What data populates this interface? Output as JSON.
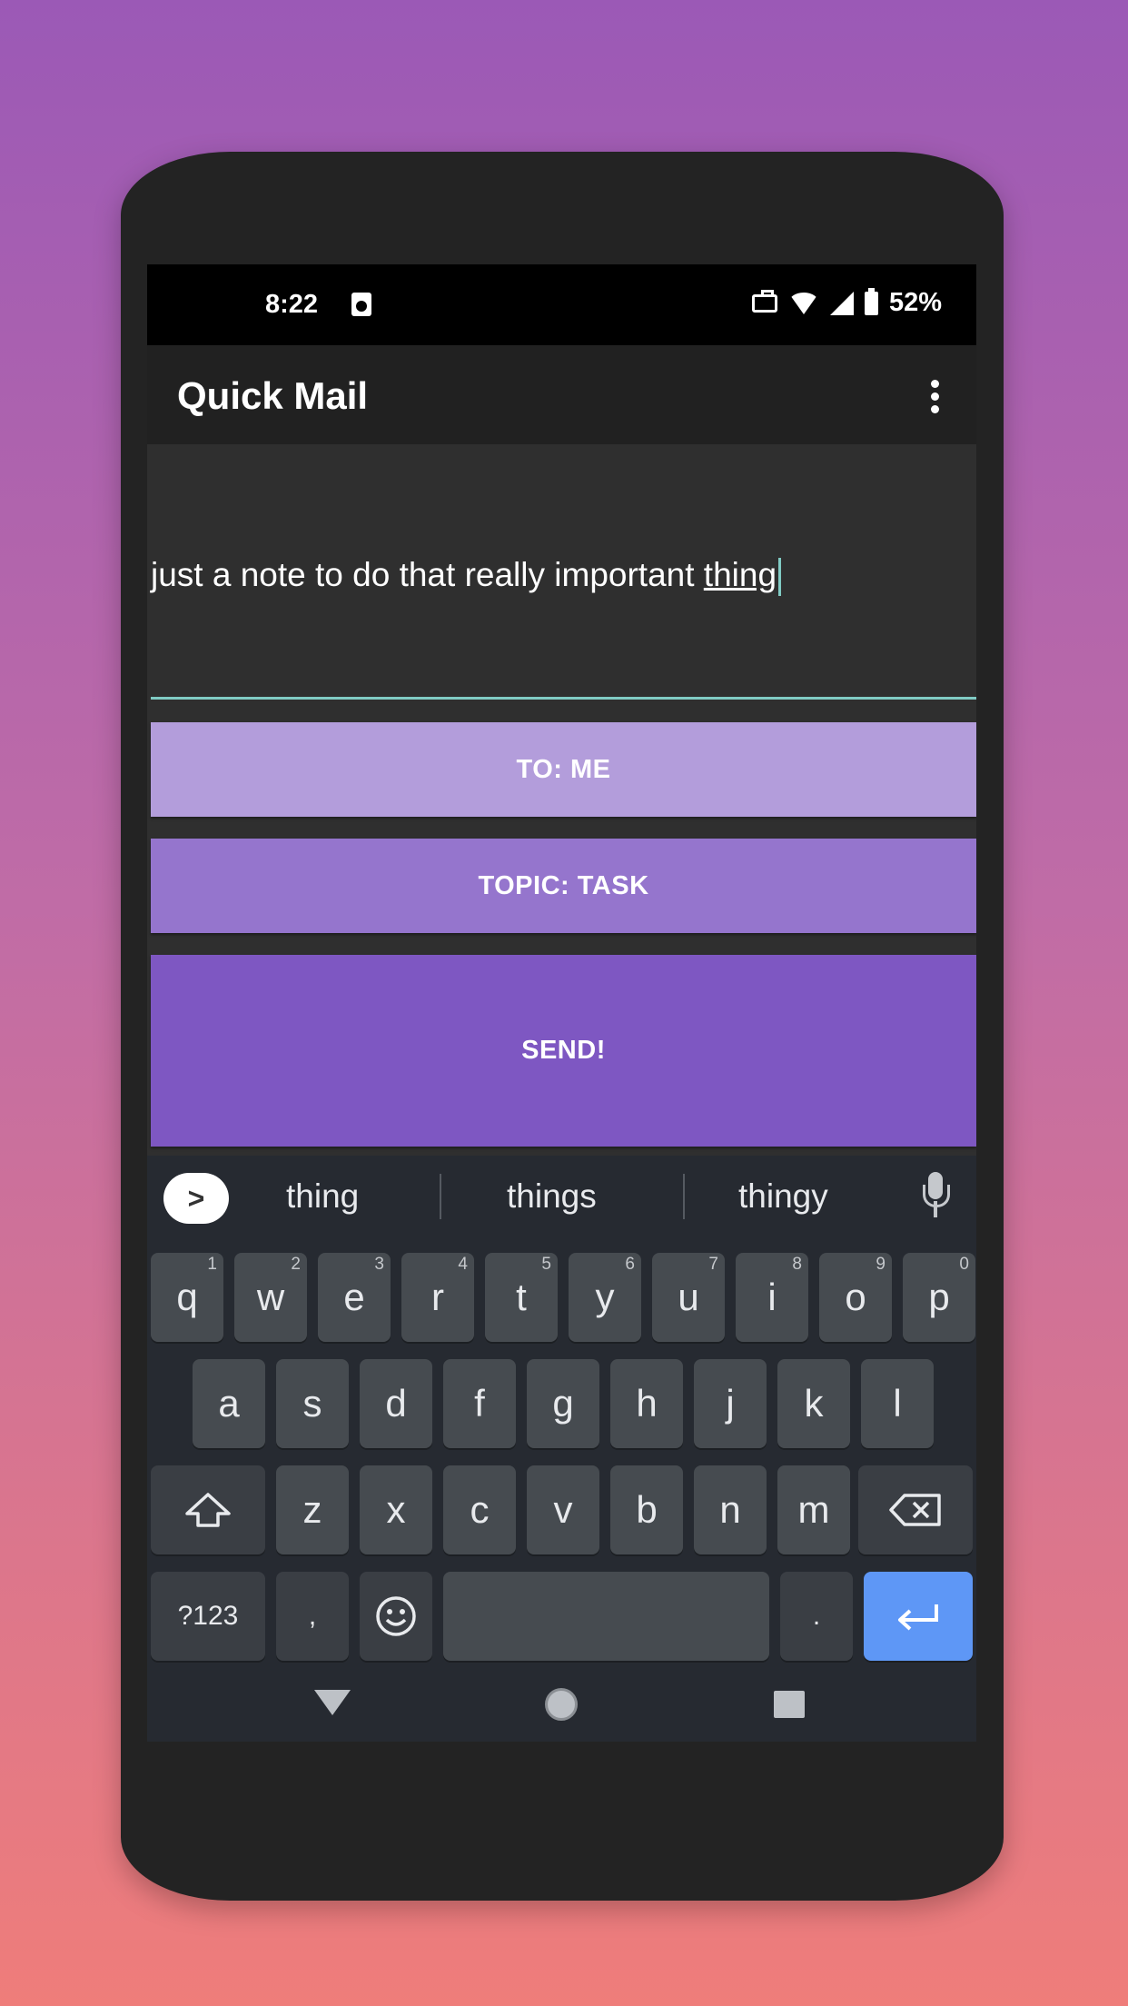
{
  "status": {
    "time": "8:22",
    "battery": "52%"
  },
  "app": {
    "title": "Quick Mail"
  },
  "editor": {
    "text_prefix": "just a note to do that really important ",
    "text_current_word": "thing"
  },
  "buttons": {
    "to": "TO: ME",
    "topic": "TOPIC: TASK",
    "send": "SEND!"
  },
  "suggestions": [
    "thing",
    "things",
    "thingy"
  ],
  "keyboard": {
    "row1": [
      {
        "k": "q",
        "h": "1"
      },
      {
        "k": "w",
        "h": "2"
      },
      {
        "k": "e",
        "h": "3"
      },
      {
        "k": "r",
        "h": "4"
      },
      {
        "k": "t",
        "h": "5"
      },
      {
        "k": "y",
        "h": "6"
      },
      {
        "k": "u",
        "h": "7"
      },
      {
        "k": "i",
        "h": "8"
      },
      {
        "k": "o",
        "h": "9"
      },
      {
        "k": "p",
        "h": "0"
      }
    ],
    "row2": [
      "a",
      "s",
      "d",
      "f",
      "g",
      "h",
      "j",
      "k",
      "l"
    ],
    "row3": [
      "z",
      "x",
      "c",
      "v",
      "b",
      "n",
      "m"
    ],
    "symbols_label": "?123",
    "comma": ",",
    "period": "."
  },
  "colors": {
    "accent": "#80cbc4",
    "button_to": "#b39ddb",
    "button_topic": "#9575cd",
    "button_send": "#7e57c2",
    "enter_key": "#5e97f6"
  },
  "icons": [
    "record-icon",
    "work-profile-icon",
    "wifi-icon",
    "signal-icon",
    "battery-icon",
    "overflow-menu-icon",
    "expand-suggestions-icon",
    "mic-icon",
    "shift-icon",
    "backspace-icon",
    "emoji-icon",
    "enter-icon",
    "nav-back-icon",
    "nav-home-icon",
    "nav-recents-icon"
  ]
}
